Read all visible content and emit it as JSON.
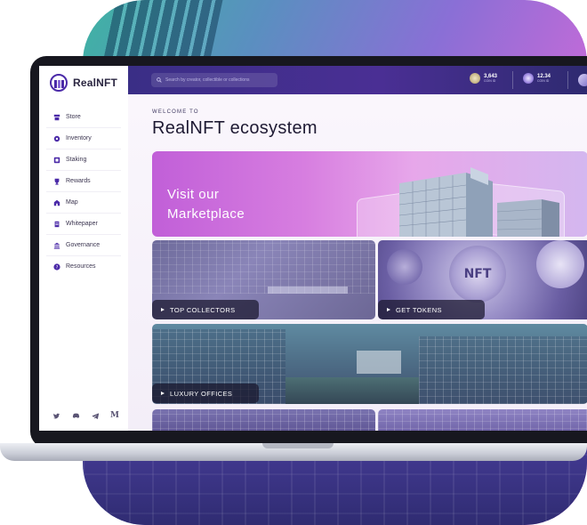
{
  "app": {
    "brand": "RealNFT"
  },
  "sidebar": {
    "items": [
      {
        "label": "Store",
        "icon": "store-icon"
      },
      {
        "label": "Inventory",
        "icon": "inventory-icon"
      },
      {
        "label": "Staking",
        "icon": "staking-icon"
      },
      {
        "label": "Rewards",
        "icon": "trophy-icon"
      },
      {
        "label": "Map",
        "icon": "map-icon"
      },
      {
        "label": "Whitepaper",
        "icon": "document-icon"
      },
      {
        "label": "Governance",
        "icon": "bank-icon"
      },
      {
        "label": "Resources",
        "icon": "help-icon"
      }
    ],
    "socials": [
      "twitter-icon",
      "discord-icon",
      "telegram-icon",
      "medium-icon"
    ],
    "medium_glyph": "M"
  },
  "header": {
    "search": {
      "placeholder": "Search by creator, collectible or collections"
    },
    "balances": [
      {
        "value": "3,643",
        "unit": "COIN ID",
        "coin_color": "#c9b98a"
      },
      {
        "value": "12.34",
        "unit": "COIN ID",
        "coin_color": "#9b86e0"
      }
    ]
  },
  "main": {
    "eyebrow": "WELCOME TO",
    "title": "RealNFT ecosystem",
    "hero": {
      "text": "Visit our Marketplace"
    },
    "tiles": [
      {
        "label": "TOP COLLECTORS"
      },
      {
        "label": "GET TOKENS",
        "badge": "NFT"
      },
      {
        "label": "LUXURY OFFICES"
      }
    ]
  },
  "colors": {
    "accent": "#4b2aa8",
    "topbar": "#3a2e86",
    "hero_start": "#c15fd8",
    "hero_end": "#d4b7ef"
  }
}
